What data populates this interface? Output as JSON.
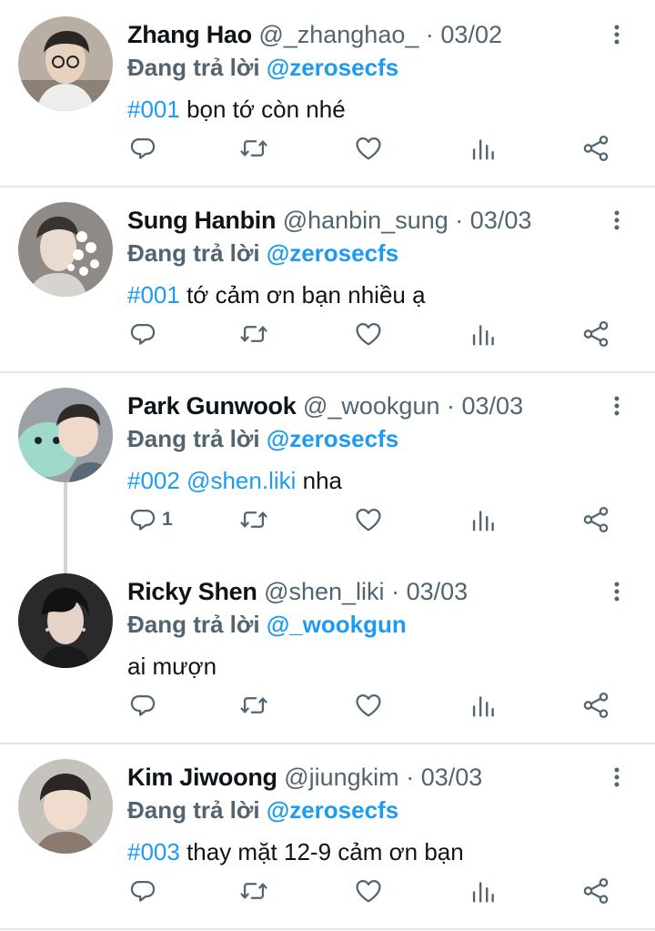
{
  "labels": {
    "replying_prefix": "Đang trả lời"
  },
  "colors": {
    "accent": "#1d9bf0",
    "secondary_text": "#536471",
    "icon": "#536471"
  },
  "icons": [
    "reply-icon",
    "retweet-icon",
    "like-icon",
    "views-icon",
    "share-icon",
    "more-icon"
  ],
  "tweets": [
    {
      "name": "Zhang Hao",
      "handle": "@_zhanghao_",
      "separator": "·",
      "date": "03/02",
      "reply_to": "@zerosecfs",
      "hashtag": "#001",
      "mention": "",
      "text": " bọn tớ còn nhé",
      "reply_count": ""
    },
    {
      "name": "Sung Hanbin",
      "handle": "@hanbin_sung",
      "separator": "·",
      "date": "03/03",
      "reply_to": "@zerosecfs",
      "hashtag": "#001",
      "mention": "",
      "text": " tớ cảm ơn bạn nhiều ạ",
      "reply_count": ""
    },
    {
      "name": "Park Gunwook",
      "handle": "@_wookgun",
      "separator": "·",
      "date": "03/03",
      "reply_to": "@zerosecfs",
      "hashtag": "#002",
      "mention": " @shen.liki",
      "text": " nha",
      "reply_count": "1"
    },
    {
      "name": "Ricky Shen",
      "handle": "@shen_liki",
      "separator": "·",
      "date": "03/03",
      "reply_to": "@_wookgun",
      "hashtag": "",
      "mention": "",
      "text": "ai mượn",
      "reply_count": ""
    },
    {
      "name": "Kim Jiwoong",
      "handle": "@jiungkim",
      "separator": "·",
      "date": "03/03",
      "reply_to": "@zerosecfs",
      "hashtag": "#003",
      "mention": "",
      "text": " thay mặt 12-9 cảm ơn bạn",
      "reply_count": ""
    }
  ]
}
